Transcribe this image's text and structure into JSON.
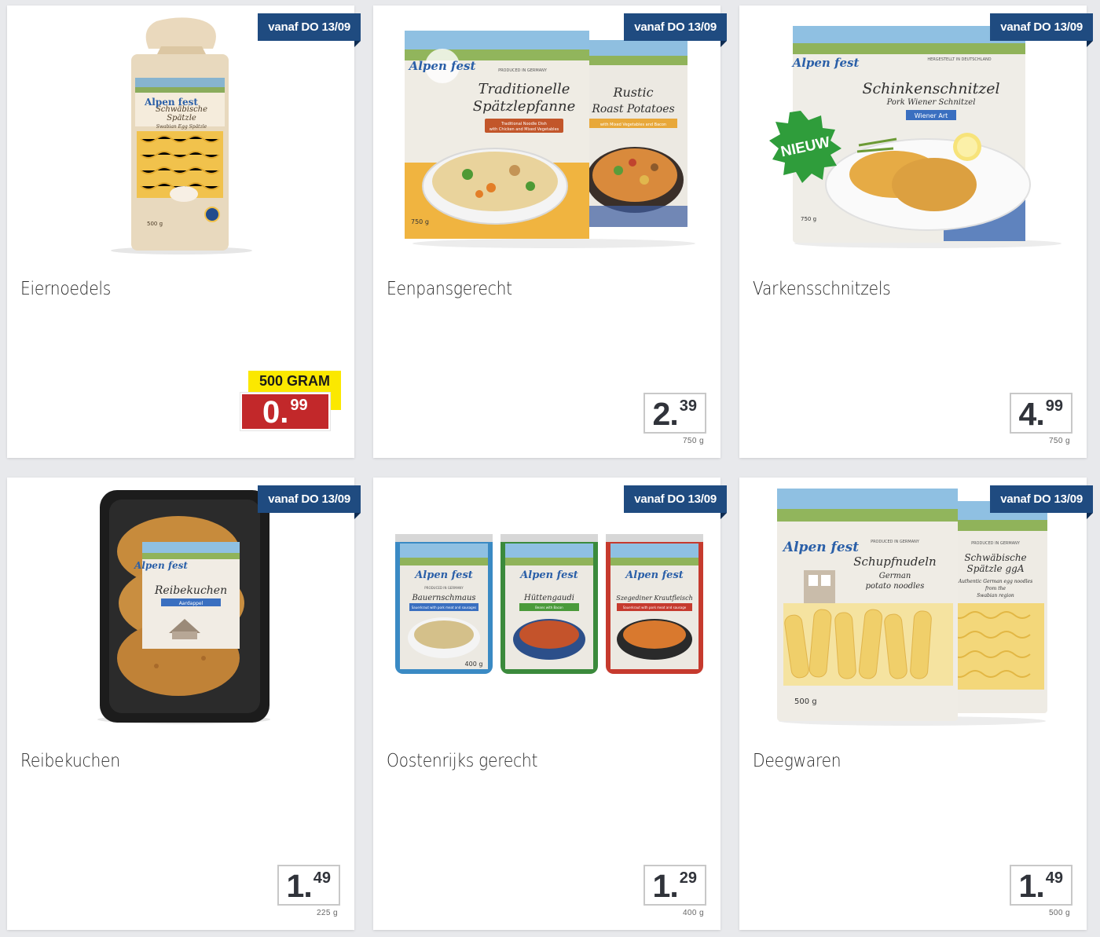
{
  "ribbon_label": "vanaf DO 13/09",
  "brand": "Alpen fest",
  "products": [
    {
      "name": "Eiernoedels",
      "promo_label": "500 GRAM",
      "price_int": "0.",
      "price_dec": "99",
      "pack_text": [
        "Schwäbische",
        "Spätzle",
        "Swabian Egg Spätzle",
        "500 g"
      ]
    },
    {
      "name": "Eenpansgerecht",
      "price_int": "2.",
      "price_dec": "39",
      "weight": "750 g",
      "pack_text": [
        "PRODUCED IN GERMANY",
        "Traditionelle",
        "Spätzlepfanne",
        "Traditional Noodle Dish",
        "with Chicken and Mixed Vegetables",
        "Rustic",
        "Roast Potatoes",
        "with Mixed Vegetables and Bacon",
        "750 g"
      ]
    },
    {
      "name": "Varkensschnitzels",
      "price_int": "4.",
      "price_dec": "99",
      "weight": "750 g",
      "badge": "NIEUW",
      "pack_text": [
        "HERGESTELLT IN DEUTSCHLAND",
        "Schinkenschnitzel",
        "Pork Wiener Schnitzel",
        "Wiener Art",
        "750 g"
      ]
    },
    {
      "name": "Reibekuchen",
      "price_int": "1.",
      "price_dec": "49",
      "weight": "225 g",
      "pack_text": [
        "Reibekuchen",
        "Aardappel"
      ]
    },
    {
      "name": "Oostenrijks gerecht",
      "price_int": "1.",
      "price_dec": "29",
      "weight": "400 g",
      "pack_text": [
        "PRODUCED IN GERMANY",
        "Bauernschmaus",
        "Sauerkraut with pork meat and sausages",
        "Hüttengaudi",
        "Beans with Bacon",
        "Szegediner Krautfleisch",
        "Sauerkraut with pork meat and sausage",
        "400 g"
      ]
    },
    {
      "name": "Deegwaren",
      "price_int": "1.",
      "price_dec": "49",
      "weight": "500 g",
      "pack_text": [
        "PRODUCED IN GERMANY",
        "Schupfnudeln",
        "German",
        "potato noodles",
        "Schwäbische",
        "Spätzle ggA",
        "Authentic German egg noodles",
        "from the",
        "Swabian region",
        "500 g"
      ]
    }
  ]
}
